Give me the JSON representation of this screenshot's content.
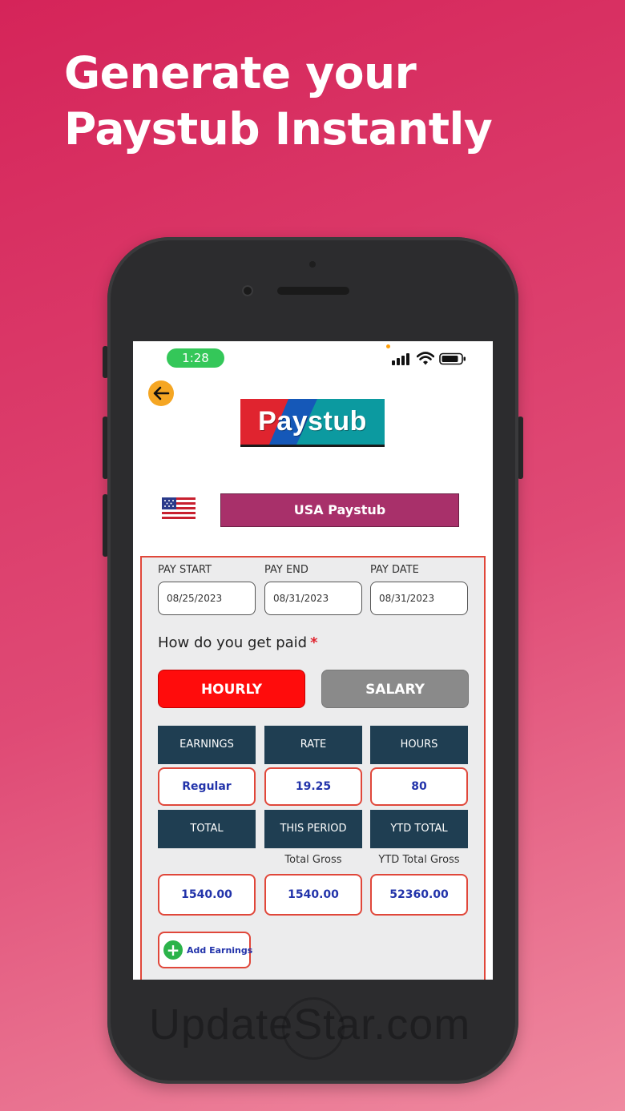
{
  "headline": {
    "line1": "Generate your",
    "line2": "Paystub Instantly"
  },
  "status_bar": {
    "time": "1:28",
    "icons": [
      "signal-icon",
      "wifi-icon",
      "battery-icon"
    ]
  },
  "header": {
    "back_icon": "arrow-left-icon",
    "logo_text": "Paystub"
  },
  "country": {
    "flag": "us-flag-icon",
    "label": "USA Paystub"
  },
  "dates": {
    "pay_start_label": "PAY START",
    "pay_start_value": "08/25/2023",
    "pay_end_label": "PAY END",
    "pay_end_value": "08/31/2023",
    "pay_date_label": "PAY DATE",
    "pay_date_value": "08/31/2023"
  },
  "payment": {
    "question": "How do you get paid",
    "required_mark": "*",
    "options": [
      "HOURLY",
      "SALARY"
    ],
    "selected": "HOURLY"
  },
  "earnings": {
    "headers": [
      "EARNINGS",
      "RATE",
      "HOURS"
    ],
    "values": [
      "Regular",
      "19.25",
      "80"
    ]
  },
  "totals": {
    "headers": [
      "TOTAL",
      "THIS PERIOD",
      "YTD TOTAL"
    ],
    "sub_labels": [
      "",
      "Total Gross",
      "YTD Total Gross"
    ],
    "values": [
      "1540.00",
      "1540.00",
      "52360.00"
    ]
  },
  "add_earnings": {
    "label": "Add Earnings",
    "icon": "plus-circle-icon"
  },
  "watermark": "UpdateStar.com",
  "colors": {
    "background": "#d52459",
    "accent_red": "#ff0c0c",
    "dark_cell": "#1f3e52",
    "country_button": "#a8306a",
    "value_text": "#2233aa"
  }
}
